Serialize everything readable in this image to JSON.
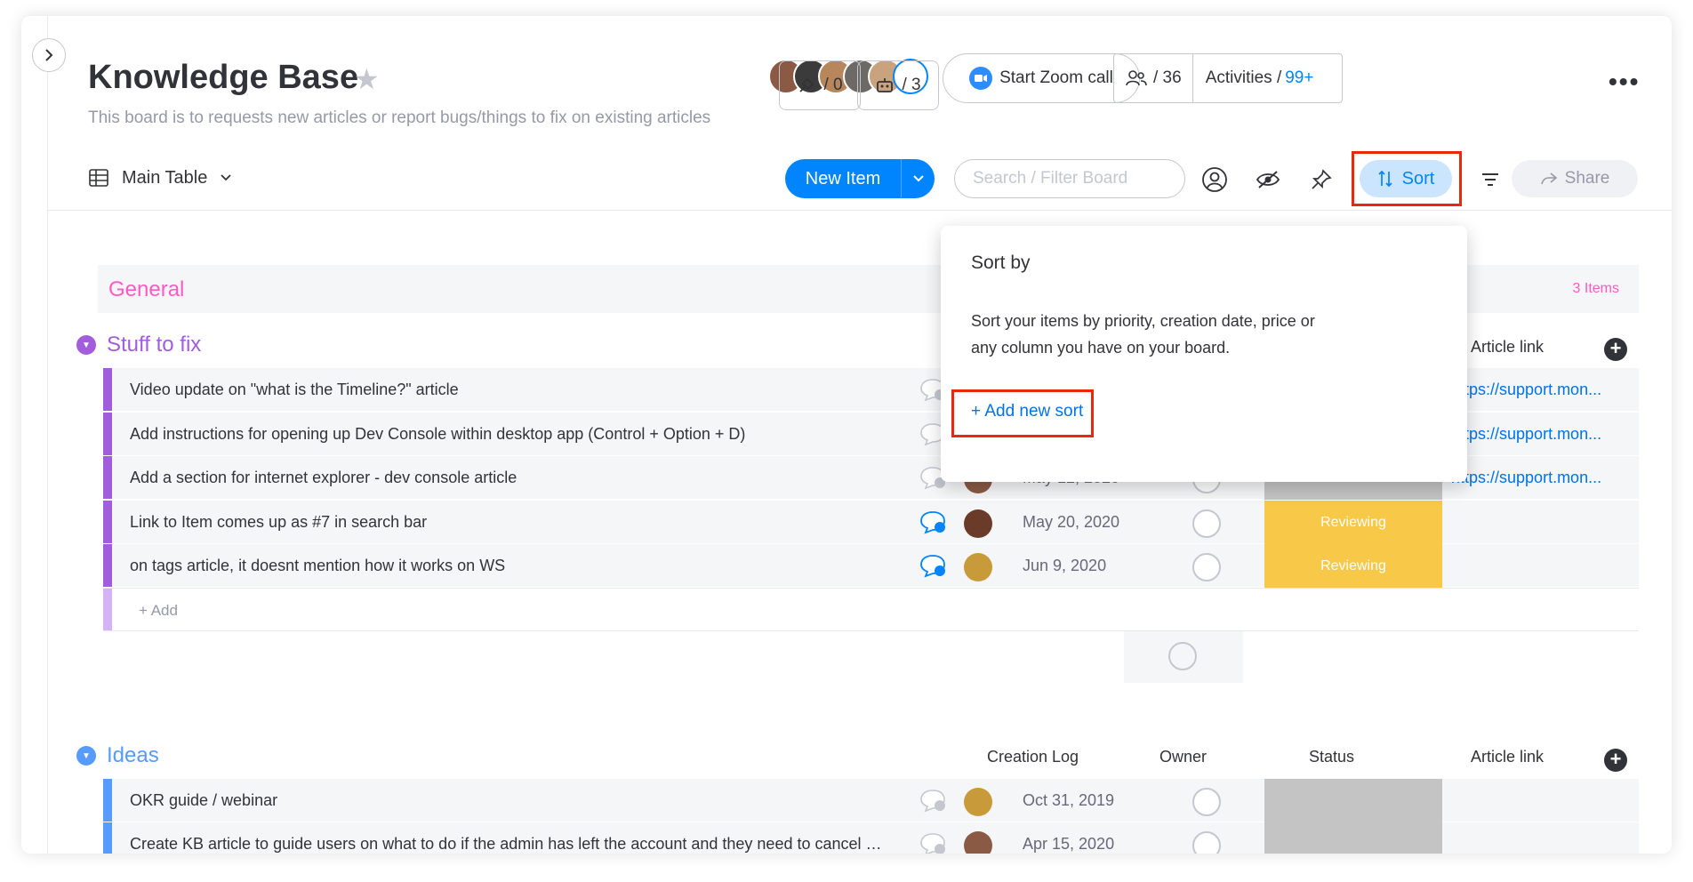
{
  "board": {
    "title": "Knowledge Base",
    "subtitle": "This board is to requests new articles or report bugs/things to fix on existing articles"
  },
  "header": {
    "integrations_count": "/ 0",
    "automations_count": "/ 3",
    "zoom_label": "Start Zoom call",
    "members_count": "/ 36",
    "activities_label": "Activities /",
    "activities_count": "99+"
  },
  "toolbar": {
    "view_label": "Main Table",
    "new_item_label": "New Item",
    "search_placeholder": "Search / Filter Board",
    "sort_label": "Sort",
    "share_label": "Share"
  },
  "sort_popup": {
    "title": "Sort by",
    "description": "Sort your items by priority, creation date, price or any column you have on your board.",
    "add_sort_label": "+ Add new sort"
  },
  "groups": {
    "general": {
      "title": "General",
      "count": "3 Items"
    },
    "stuff": {
      "title": "Stuff to fix",
      "col_link": "Article link",
      "add_label": "+ Add",
      "rows": [
        {
          "name": "Video update on \"what is the Timeline?\" article",
          "date": "",
          "status": "",
          "link": "https://support.mon..."
        },
        {
          "name": "Add instructions for opening up Dev Console within desktop app (Control + Option + D)",
          "date": "",
          "status": "",
          "link": "https://support.mon..."
        },
        {
          "name": "Add a section for internet explorer - dev console article",
          "date": "May 12, 2020",
          "status": "",
          "link": "https://support.mon..."
        },
        {
          "name": "Link to Item comes up as #7 in search bar",
          "date": "May 20, 2020",
          "status": "Reviewing",
          "link": ""
        },
        {
          "name": "on tags article, it doesnt mention how it works on WS",
          "date": "Jun 9, 2020",
          "status": "Reviewing",
          "link": ""
        }
      ]
    },
    "ideas": {
      "title": "Ideas",
      "col_creation": "Creation Log",
      "col_owner": "Owner",
      "col_status": "Status",
      "col_link": "Article link",
      "rows": [
        {
          "name": "OKR guide / webinar",
          "date": "Oct 31, 2019"
        },
        {
          "name": "Create KB article to guide users on what to do if the admin has left the account and they need to cancel or...",
          "date": "Apr 15, 2020"
        }
      ]
    }
  },
  "colors": {
    "primary": "#0085ff",
    "highlight": "#e8290b",
    "general": "#ff5ac4",
    "stuff": "#a25ddc",
    "ideas": "#579bfc",
    "reviewing": "#f8c848",
    "status_empty": "#c4c4c4"
  }
}
